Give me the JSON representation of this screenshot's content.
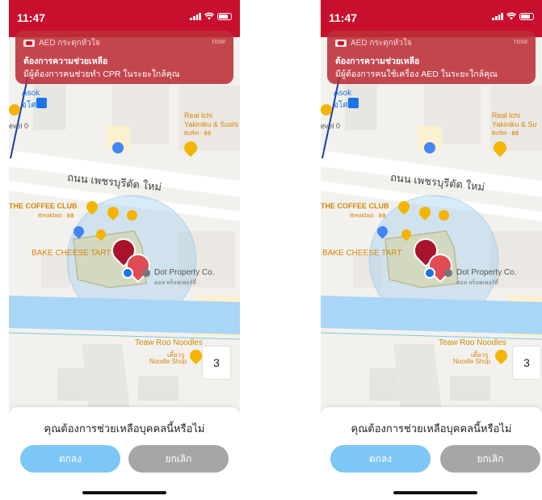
{
  "screens": [
    {
      "status": {
        "time": "11:47"
      },
      "notification": {
        "app_name": "AED กระตุกหัวใจ",
        "time": "now",
        "title": "ต้องการความช่วยเหลือ",
        "body": "มีผู้ต้องการคนช่วยทำ CPR ในระยะใกล้คุณ"
      },
      "map": {
        "station": "Asok",
        "station_th": "อโศก",
        "level": "evel 0",
        "road": "ถนน เพชรบุรีตัด ใหม่",
        "real_ichi": "Real Ichi",
        "real_ichi_2": "Yakiniku & Sushi",
        "real_ichi_sub": "Buffet · ฿฿",
        "coffee_club": "THE COFFEE CLUB",
        "coffee_sub": "Breakfast · ฿฿",
        "bake_cheese": "BAKE CHEESE TART",
        "dot_property": "Dot Property Co.",
        "dot_sub": "ดอท พร็อพเพอร์ตี้",
        "teaw_roo": "Teaw Roo Noodles",
        "teaw_th": "เตี๋ยวรู",
        "teaw_sub": "Noodle Shop",
        "number_button": "3"
      },
      "sheet": {
        "question": "คุณต้องการช่วยเหลือบุคคลนี้หรือไม่",
        "ok_label": "ตกลง",
        "cancel_label": "ยกเลิก"
      }
    },
    {
      "status": {
        "time": "11:47"
      },
      "notification": {
        "app_name": "AED กระตุกหัวใจ",
        "time": "now",
        "title": "ต้องการความช่วยเหลือ",
        "body": "มีผู้ต้องการคนใช้เครื่อง AED ในระยะใกล้คุณ"
      },
      "map": {
        "station": "Asok",
        "station_th": "อโศก",
        "level": "evel 0",
        "road": "ถนน เพชรบุรีตัด ใหม่",
        "real_ichi": "Real Ichi",
        "real_ichi_2": "Yakiniku & Su",
        "real_ichi_sub": "Buffet · ฿฿",
        "coffee_club": "THE COFFEE CLUB",
        "coffee_sub": "Breakfast · ฿฿",
        "bake_cheese": "BAKE CHEESE TART",
        "dot_property": "Dot Property Co.",
        "dot_sub": "ดอท พร็อพเพอร์ตี้",
        "teaw_roo": "Teaw Roo Noodles",
        "teaw_th": "เตี๋ยวรู",
        "teaw_sub": "Noodle Shop",
        "number_button": "3"
      },
      "sheet": {
        "question": "คุณต้องการช่วยเหลือบุคคลนี้หรือไม่",
        "ok_label": "ตกลง",
        "cancel_label": "ยกเลิก"
      }
    }
  ],
  "colors": {
    "brand_red": "#c8102e",
    "ok_button": "#7cc7f6",
    "cancel_button": "#a6a6a6",
    "water": "#a9d6f7"
  },
  "icons": [
    "location-arrow-icon",
    "signal-icon",
    "wifi-icon",
    "battery-icon",
    "aed-marker-icon",
    "person-marker-icon",
    "restaurant-icon",
    "cafe-icon",
    "shopping-icon",
    "train-icon"
  ]
}
